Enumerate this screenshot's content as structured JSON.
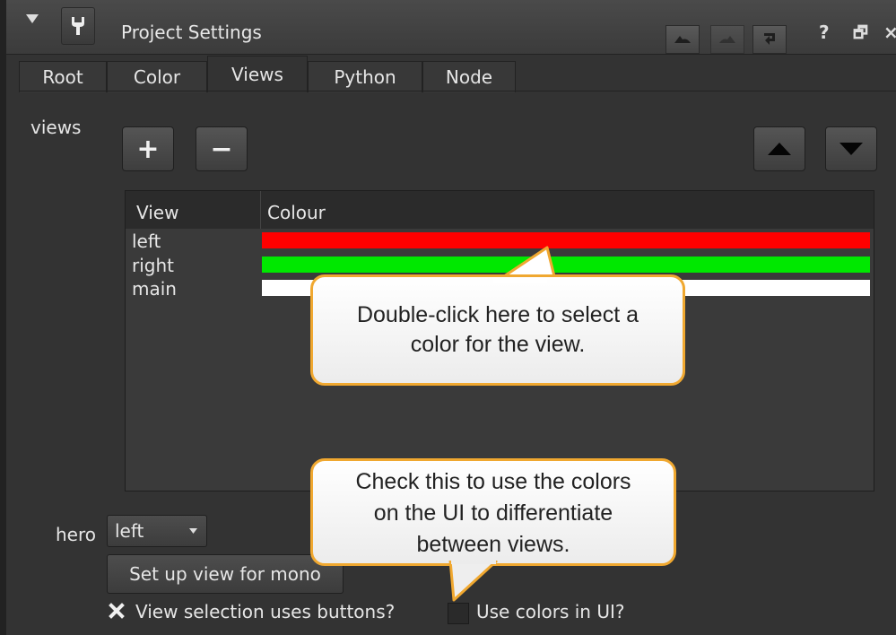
{
  "window": {
    "title": "Project Settings",
    "help_label": "?",
    "float_label": "🗗",
    "close_label": "×"
  },
  "tabs": [
    {
      "label": "Root",
      "active": false
    },
    {
      "label": "Color",
      "active": false
    },
    {
      "label": "Views",
      "active": true
    },
    {
      "label": "Python",
      "active": false
    },
    {
      "label": "Node",
      "active": false
    }
  ],
  "views_section": {
    "label": "views",
    "add_label": "+",
    "remove_label": "−"
  },
  "table": {
    "columns": [
      "View",
      "Colour"
    ],
    "rows": [
      {
        "view": "left",
        "color": "#ff0000"
      },
      {
        "view": "right",
        "color": "#00e800"
      },
      {
        "view": "main",
        "color": "#ffffff"
      }
    ]
  },
  "hero": {
    "label": "hero",
    "selected": "left"
  },
  "mono_button": "Set up view for mono",
  "checkboxes": [
    {
      "label": "View selection uses buttons?",
      "checked": true
    },
    {
      "label": "Use colors in UI?",
      "checked": false
    }
  ],
  "callouts": {
    "color_tip": [
      "Double-click here to select a",
      "color for the view."
    ],
    "ui_tip": [
      "Check this to use the colors",
      "on the UI to differentiate",
      "between views."
    ]
  },
  "colors": {
    "panel_bg": "#333333",
    "callout_border": "#f0a830"
  }
}
